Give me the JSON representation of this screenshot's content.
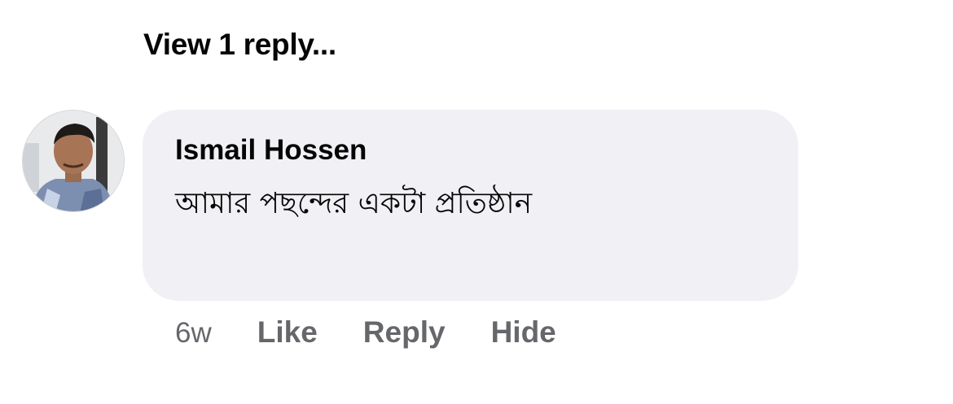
{
  "thread": {
    "view_replies_label": "View 1 reply..."
  },
  "comment": {
    "author": "Ismail Hossen",
    "text": "আমার পছন্দের একটা প্রতিষ্ঠান",
    "timestamp": "6w",
    "actions": {
      "like": "Like",
      "reply": "Reply",
      "hide": "Hide"
    },
    "avatar_icon": "profile-photo"
  },
  "colors": {
    "bubble_bg": "#f0f0f5",
    "primary_text": "#050505",
    "secondary_text": "#65676b"
  }
}
